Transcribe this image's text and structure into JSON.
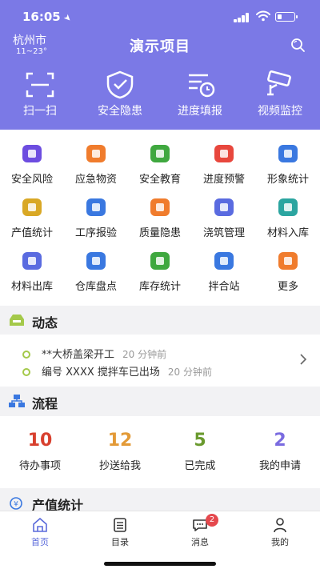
{
  "status": {
    "time": "16:05",
    "battery_level": 0.3
  },
  "header": {
    "city": "杭州市",
    "temperature": "11~23°",
    "title": "演示项目",
    "quick_actions": [
      {
        "label": "扫一扫",
        "icon": "scan-icon"
      },
      {
        "label": "安全隐患",
        "icon": "shield-check-icon"
      },
      {
        "label": "进度填报",
        "icon": "schedule-icon"
      },
      {
        "label": "视频监控",
        "icon": "camera-icon"
      }
    ]
  },
  "modules": [
    {
      "label": "安全风险",
      "icon": "lightning-shield-icon",
      "color": "#6d4de0"
    },
    {
      "label": "应急物资",
      "icon": "emergency-icon",
      "color": "#f07c2d"
    },
    {
      "label": "安全教育",
      "icon": "education-book-icon",
      "color": "#3fa83f"
    },
    {
      "label": "进度预警",
      "icon": "alarm-light-icon",
      "color": "#e8473d"
    },
    {
      "label": "形象统计",
      "icon": "bar-chart-icon",
      "color": "#3a78e0"
    },
    {
      "label": "产值统计",
      "icon": "coins-icon",
      "color": "#d9a825"
    },
    {
      "label": "工序报验",
      "icon": "document-search-icon",
      "color": "#3a78e0"
    },
    {
      "label": "质量隐患",
      "icon": "warning-shield-icon",
      "color": "#f07c2d"
    },
    {
      "label": "浇筑管理",
      "icon": "pour-icon",
      "color": "#5a6be0"
    },
    {
      "label": "材料入库",
      "icon": "warehouse-in-icon",
      "color": "#2ba5a0"
    },
    {
      "label": "材料出库",
      "icon": "warehouse-out-icon",
      "color": "#5a6be0"
    },
    {
      "label": "仓库盘点",
      "icon": "warehouse-check-icon",
      "color": "#3a78e0"
    },
    {
      "label": "库存统计",
      "icon": "stock-icon",
      "color": "#3fa83f"
    },
    {
      "label": "拌合站",
      "icon": "mixing-station-icon",
      "color": "#3a78e0"
    },
    {
      "label": "更多",
      "icon": "grid-more-icon",
      "color": "#f07c2d"
    }
  ],
  "feed": {
    "title": "动态",
    "items": [
      {
        "text": "**大桥盖梁开工",
        "time": "20 分钟前"
      },
      {
        "text": "编号 XXXX 搅拌车已出场",
        "time": "20 分钟前"
      }
    ]
  },
  "flow": {
    "title": "流程",
    "items": [
      {
        "count": "10",
        "label": "待办事项",
        "color": "#d8402e"
      },
      {
        "count": "12",
        "label": "抄送给我",
        "color": "#e39a37"
      },
      {
        "count": "5",
        "label": "已完成",
        "color": "#6a9a2e"
      },
      {
        "count": "2",
        "label": "我的申请",
        "color": "#7a6be0"
      }
    ]
  },
  "output": {
    "title": "产值统计"
  },
  "tabs": [
    {
      "label": "首页",
      "icon": "home-icon"
    },
    {
      "label": "目录",
      "icon": "catalog-icon"
    },
    {
      "label": "消息",
      "icon": "message-icon",
      "badge": "2"
    },
    {
      "label": "我的",
      "icon": "user-icon"
    }
  ],
  "colors": {
    "header": "#7b79e6",
    "accent": "#5b6bdb"
  }
}
